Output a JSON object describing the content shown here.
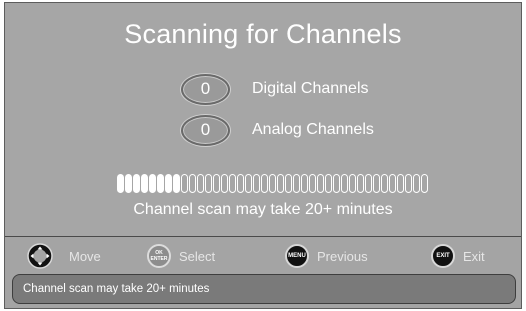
{
  "title": "Scanning for Channels",
  "counts": [
    {
      "value": "0",
      "label": "Digital Channels"
    },
    {
      "value": "0",
      "label": "Analog Channels"
    }
  ],
  "progress": {
    "filled_segments": 8,
    "total_segments": 39
  },
  "scan_note": "Channel scan may take 20+ minutes",
  "footer": {
    "hints": [
      {
        "icon": "dpad-icon",
        "button_text": "",
        "label": "Move"
      },
      {
        "icon": "ok-enter-button-icon",
        "button_text": "OK ENTER",
        "label": "Select"
      },
      {
        "icon": "menu-button-icon",
        "button_text": "MENU",
        "label": "Previous"
      },
      {
        "icon": "exit-button-icon",
        "button_text": "EXIT",
        "label": "Exit"
      }
    ],
    "info_text": "Channel scan may take 20+ minutes"
  },
  "colors": {
    "panel": "#a6a6a6",
    "info_bar": "#7a7a7a",
    "text": "#ffffff"
  }
}
